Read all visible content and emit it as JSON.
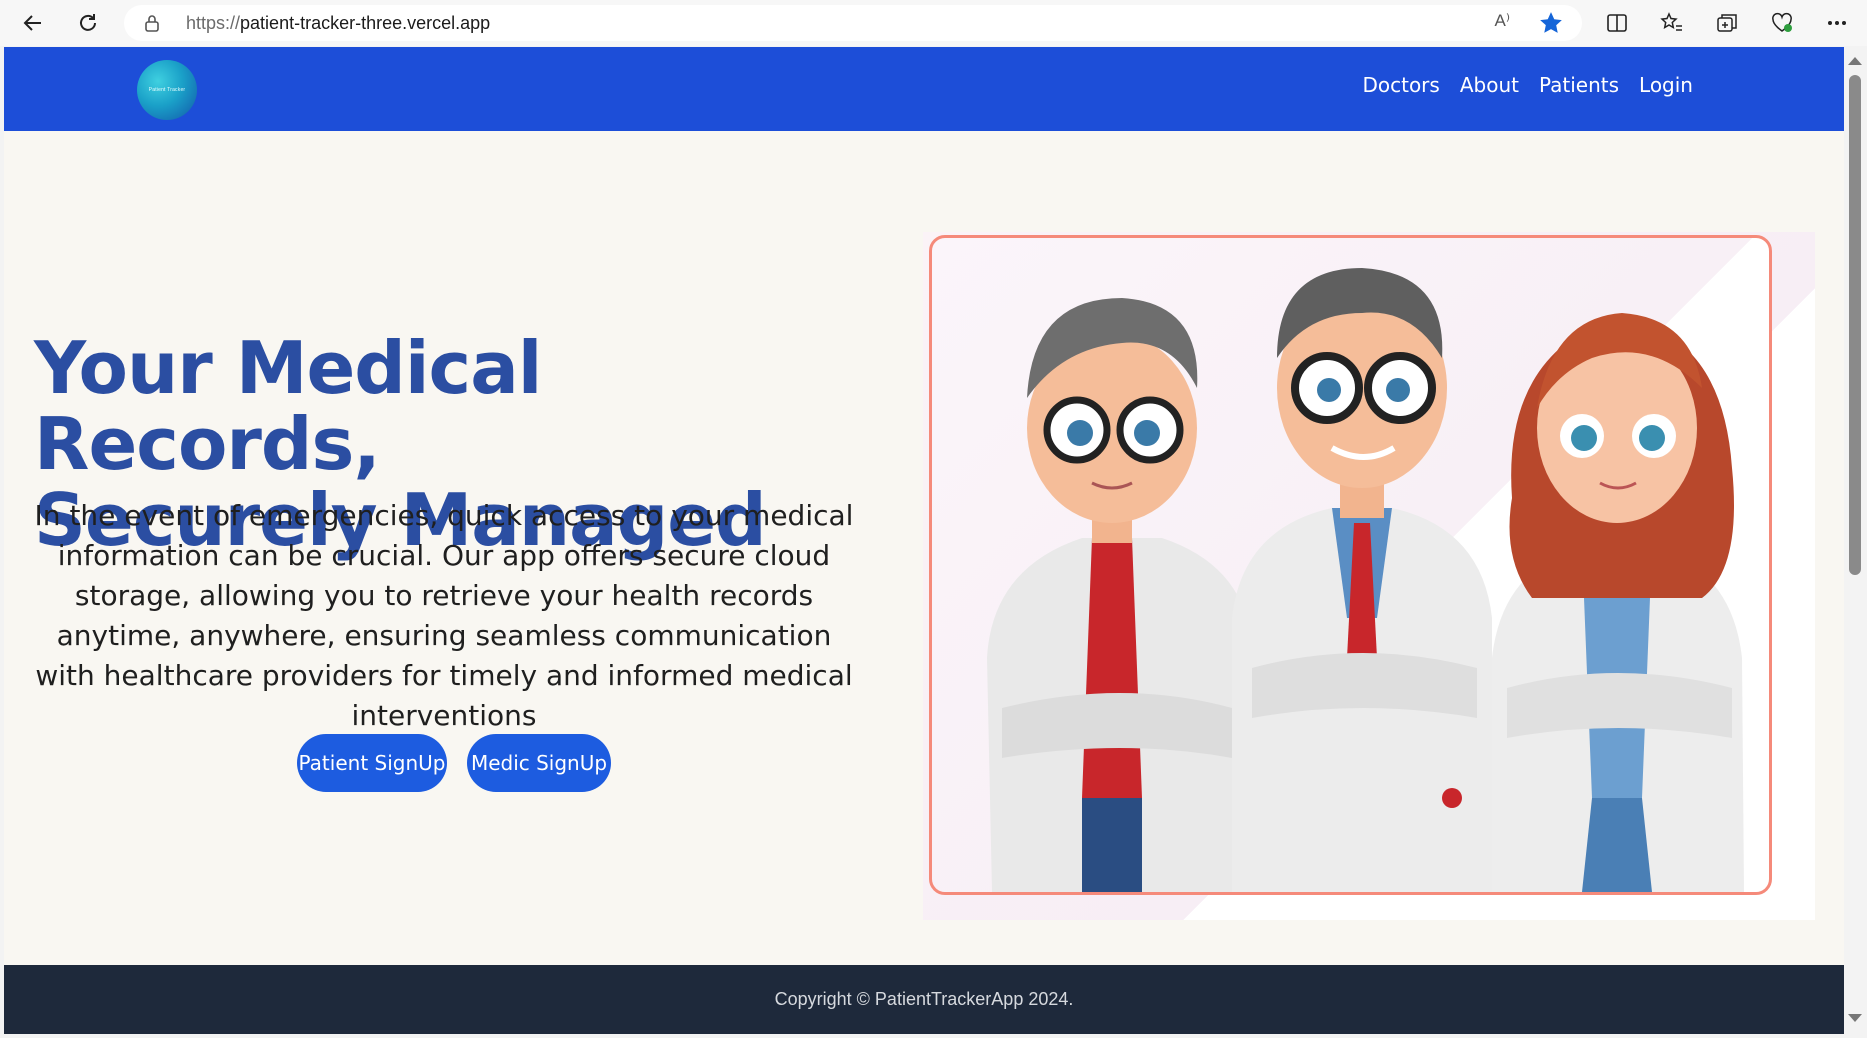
{
  "browser": {
    "url_protocol": "https://",
    "url_host": "patient-tracker-three.vercel.app",
    "read_aloud_label": "A⁾"
  },
  "nav": {
    "logo_text": "Patient Tracker",
    "links": [
      "Doctors",
      "About",
      "Patients",
      "Login"
    ]
  },
  "hero": {
    "title_line1": "Your Medical Records,",
    "title_line2": "Securely Managed",
    "description": "In the event of emergencies, quick access to your medical information can be crucial. Our app offers secure cloud storage, allowing you to retrieve your health records anytime, anywhere, ensuring seamless communication with healthcare providers for timely and informed medical interventions",
    "buttons": [
      "Patient SignUp",
      "Medic SignUp"
    ]
  },
  "footer": {
    "copyright": "Copyright © PatientTrackerApp 2024."
  },
  "colors": {
    "navbar": "#1d4ed8",
    "title": "#2b4ea2",
    "button": "#1d5ce0",
    "footer": "#1e293b",
    "frame": "#f58a7a"
  }
}
